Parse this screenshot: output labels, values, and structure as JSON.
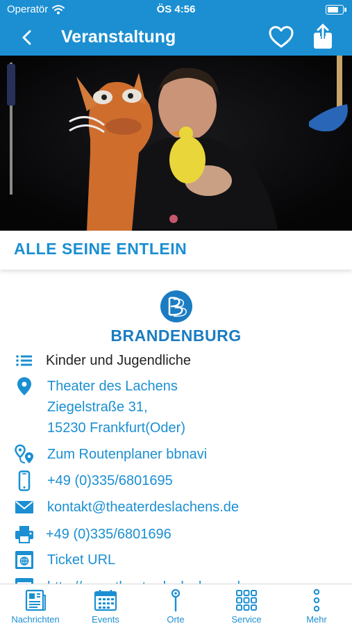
{
  "status": {
    "carrier": "Operatör",
    "time": "ÖS 4:56",
    "battery_level": 0.85
  },
  "nav": {
    "title": "Veranstaltung"
  },
  "event": {
    "title": "ALLE SEINE ENTLEIN"
  },
  "logo": {
    "text": "BRANDENBURG"
  },
  "details": {
    "category": "Kinder und Jugendliche",
    "venue_name": "Theater des Lachens",
    "street": "Ziegelstraße 31,",
    "city": "15230 Frankfurt(Oder)",
    "route_link": "Zum Routenplaner bbnavi",
    "phone": "+49 (0)335/6801695",
    "email": "kontakt@theaterdeslachens.de",
    "fax": "+49 (0)335/6801696",
    "ticket": "Ticket URL",
    "website_partial": "http://www.theaterdeslachens.de"
  },
  "tabs": [
    {
      "label": "Nachrichten",
      "icon": "newspaper-icon"
    },
    {
      "label": "Events",
      "icon": "calendar-icon"
    },
    {
      "label": "Orte",
      "icon": "map-pin-icon"
    },
    {
      "label": "Service",
      "icon": "grid-icon"
    },
    {
      "label": "Mehr",
      "icon": "more-dots-icon"
    }
  ],
  "colors": {
    "brand": "#1b8fd2",
    "text_dark": "#222222"
  }
}
